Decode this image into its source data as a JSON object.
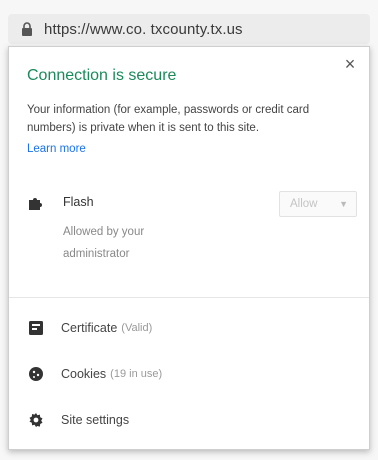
{
  "omnibox": {
    "url": "https://www.co. txcounty.tx.us",
    "lock_icon": "lock-icon"
  },
  "popup": {
    "title": "Connection is secure",
    "description": "Your information (for example, passwords or credit card numbers) is private when it is sent to this site.",
    "learn_more": "Learn more",
    "close": "×",
    "permission": {
      "name": "Flash",
      "sub_line1": "Allowed by your",
      "sub_line2": "administrator",
      "select_value": "Allow",
      "icon": "puzzle-icon"
    },
    "rows": {
      "certificate": {
        "label": "Certificate",
        "sub": "(Valid)",
        "icon": "certificate-icon"
      },
      "cookies": {
        "label": "Cookies",
        "sub": "(19 in use)",
        "icon": "cookie-icon"
      },
      "site_settings": {
        "label": "Site settings",
        "icon": "gear-icon"
      }
    }
  },
  "colors": {
    "secure_title": "#1b8a5a",
    "link": "#1a73e8"
  }
}
